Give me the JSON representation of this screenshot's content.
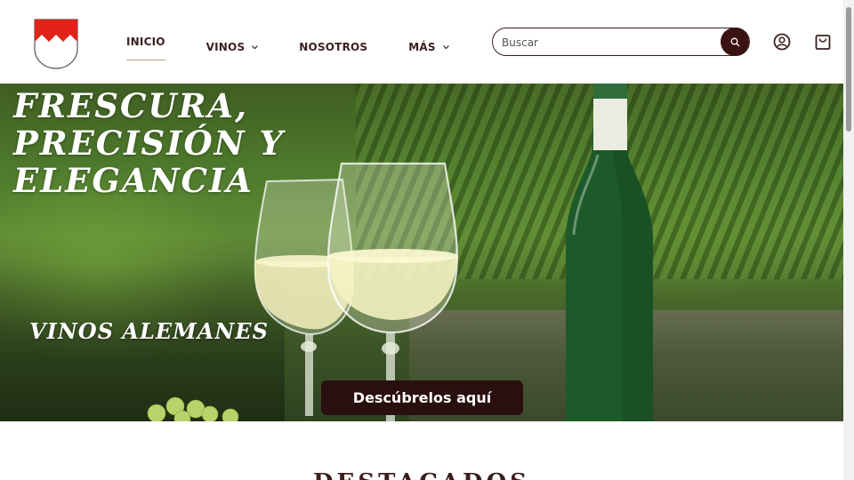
{
  "brand": {
    "logo_icon": "franconian-rake-shield",
    "colors": {
      "red": "#e2231a",
      "white": "#ffffff"
    }
  },
  "nav": {
    "items": [
      {
        "label": "INICIO",
        "active": true,
        "has_dropdown": false
      },
      {
        "label": "VINOS",
        "active": false,
        "has_dropdown": true
      },
      {
        "label": "NOSOTROS",
        "active": false,
        "has_dropdown": false
      },
      {
        "label": "MÁS",
        "active": false,
        "has_dropdown": true
      }
    ]
  },
  "search": {
    "placeholder": "Buscar",
    "value": "",
    "icon": "search-icon"
  },
  "header_icons": {
    "account": "account-icon",
    "cart": "shopping-bag-icon"
  },
  "hero": {
    "title": "FRESCURA, PRECISIÓN Y ELEGANCIA",
    "subtitle": "VINOS ALEMANES",
    "cta_label": "Descúbrelos aquí"
  },
  "section": {
    "title": "DESTACADOS"
  },
  "theme": {
    "primary": "#2a0f0f",
    "text": "#3b1f1f",
    "accent_underline": "#b8a48a"
  }
}
